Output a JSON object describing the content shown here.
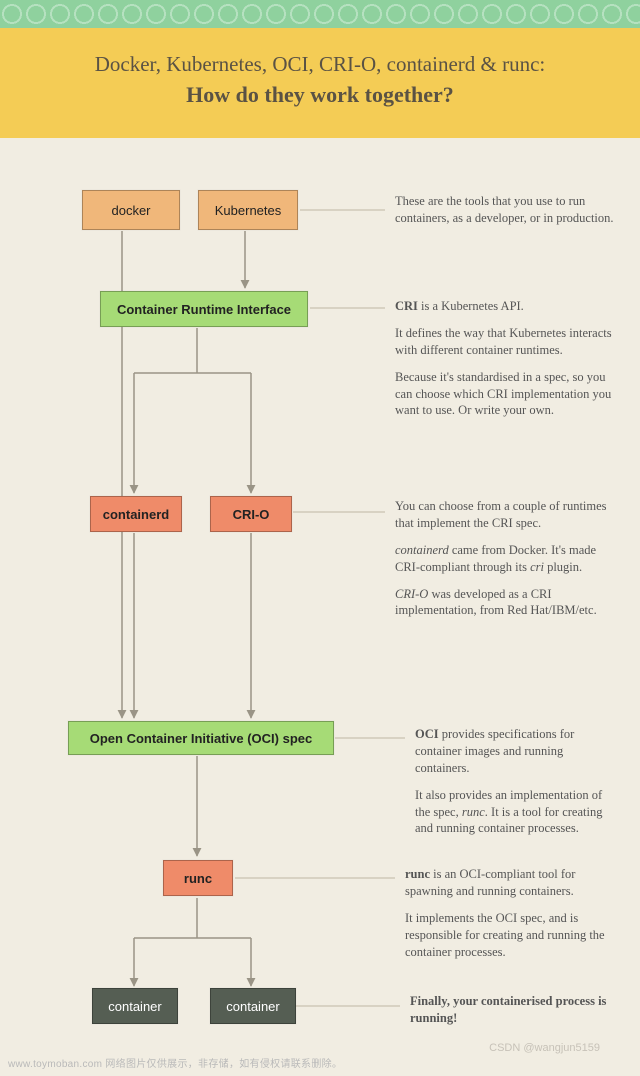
{
  "header": {
    "title_line1": "Docker, Kubernetes, OCI, CRI-O, containerd & runc:",
    "title_line2": "How do they work together?"
  },
  "nodes": {
    "docker": "docker",
    "kubernetes": "Kubernetes",
    "cri": "Container Runtime Interface",
    "containerd": "containerd",
    "crio": "CRI-O",
    "oci": "Open Container Initiative (OCI) spec",
    "runc": "runc",
    "container_a": "container",
    "container_b": "container"
  },
  "descriptions": {
    "tools": "These are the tools that you use to run containers, as a developer, or in production.",
    "cri_p1": "<b>CRI</b> is a Kubernetes API.",
    "cri_p2": "It defines the way that Kubernetes interacts with different container runtimes.",
    "cri_p3": "Because it's standardised in a spec, so you can choose which CRI implementation you want to use. Or write your own.",
    "rt_p1": "You can choose from a couple of runtimes that implement the CRI spec.",
    "rt_p2": "<i>containerd</i> came from Docker. It's made CRI-compliant through its <i>cri</i> plugin.",
    "rt_p3": "<i>CRI-O</i> was developed as a CRI implementation, from Red Hat/IBM/etc.",
    "oci_p1": "<b>OCI</b> provides specifications for container images and running containers.",
    "oci_p2": "It also provides an implementation of the spec, <i>runc</i>. It is a tool for creating and running container processes.",
    "runc_p1": "<b>runc</b> is an OCI-compliant tool for spawning and running containers.",
    "runc_p2": "It implements the OCI spec, and is responsible for creating and running the container processes.",
    "final": "Finally, your containerised process is running!"
  },
  "watermarks": {
    "bottom_left": "www.toymoban.com 网络图片仅供展示，非存储，如有侵权请联系删除。",
    "bottom_right": "CSDN @wangjun5159"
  }
}
